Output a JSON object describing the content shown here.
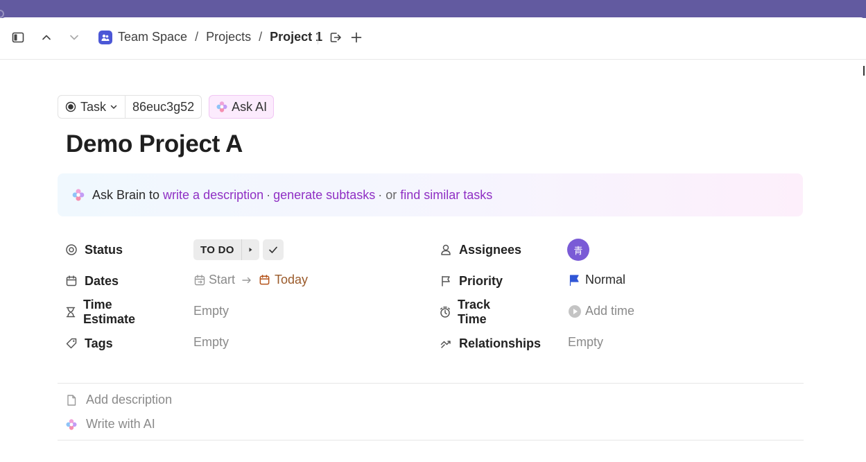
{
  "colors": {
    "top_strip": "#625aa0",
    "space_icon": "#4b57d6",
    "ai_link": "#8f2fc4",
    "avatar": "#7a5bd6",
    "priority_flag": "#3056d6",
    "due_today": "#9a5a2a"
  },
  "header": {
    "breadcrumbs": [
      "Team Space",
      "Projects",
      "Project 1"
    ],
    "icons": [
      "sidebar-toggle-icon",
      "chevron-up-icon",
      "chevron-down-icon",
      "team-space-icon",
      "share-icon",
      "plus-icon"
    ]
  },
  "task": {
    "type_label": "Task",
    "id": "86euc3g52",
    "ask_ai_label": "Ask AI",
    "title": "Demo Project A"
  },
  "brain": {
    "prefix": "Ask Brain to",
    "link1": "write a description",
    "sep": "·",
    "link2": "generate subtasks",
    "connector": "· or",
    "link3": "find similar tasks"
  },
  "fields": {
    "status": {
      "label": "Status",
      "value": "TO DO"
    },
    "dates": {
      "label": "Dates",
      "start": "Start",
      "due": "Today"
    },
    "time_estimate": {
      "label": "Time Estimate",
      "value": "Empty"
    },
    "tags": {
      "label": "Tags",
      "value": "Empty"
    },
    "assignees": {
      "label": "Assignees",
      "avatar_initial": "青"
    },
    "priority": {
      "label": "Priority",
      "value": "Normal"
    },
    "track_time": {
      "label": "Track Time",
      "value": "Add time"
    },
    "relationships": {
      "label": "Relationships",
      "value": "Empty"
    }
  },
  "description": {
    "add_label": "Add description",
    "ai_label": "Write with AI"
  }
}
